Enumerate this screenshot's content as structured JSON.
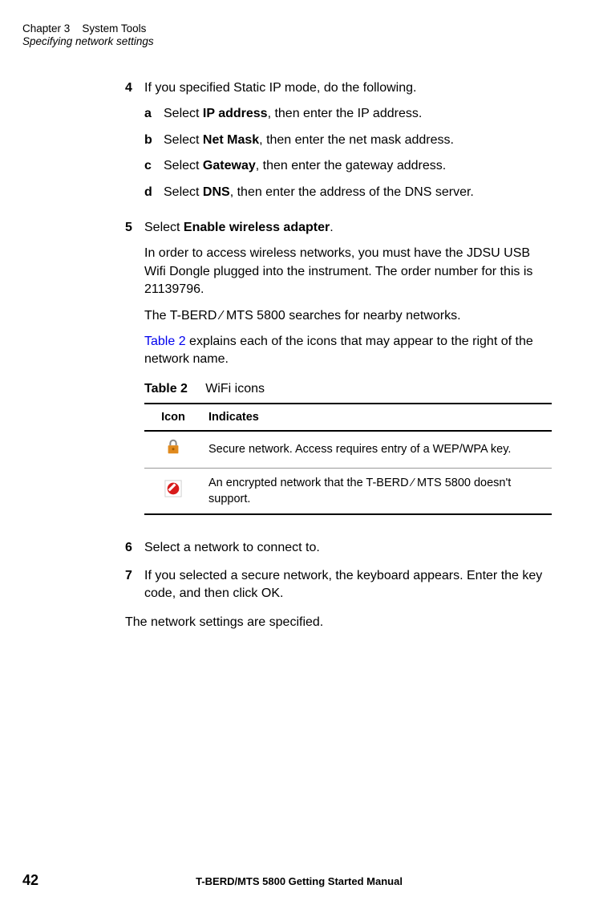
{
  "header": {
    "chapter_prefix": "Chapter 3",
    "chapter_title": "System Tools",
    "section": "Specifying network settings"
  },
  "steps": {
    "s4": {
      "num": "4",
      "intro": "If you specified Static IP mode, do the following.",
      "a": {
        "label": "a",
        "pre": "Select ",
        "bold": "IP address",
        "post": ", then enter the IP address."
      },
      "b": {
        "label": "b",
        "pre": "Select ",
        "bold": "Net Mask",
        "post": ", then enter the net mask address."
      },
      "c": {
        "label": "c",
        "pre": "Select ",
        "bold": "Gateway",
        "post": ", then enter the gateway address."
      },
      "d": {
        "label": "d",
        "pre": "Select ",
        "bold": "DNS",
        "post": ", then enter the address of the DNS server."
      }
    },
    "s5": {
      "num": "5",
      "pre": "Select ",
      "bold": "Enable wireless adapter",
      "post": ".",
      "para1": "In order to access wireless networks, you must have the JDSU USB Wifi Dongle plugged into the instrument. The order number for this is 21139796.",
      "para2": "The T-BERD ⁄ MTS 5800 searches for nearby networks.",
      "para3_link": "Table 2",
      "para3_rest": " explains each of the icons that may appear to the right of the network name."
    },
    "s6": {
      "num": "6",
      "text": "Select a network to connect to."
    },
    "s7": {
      "num": "7",
      "text": "If you selected a secure network, the keyboard appears. Enter the key code, and then click OK."
    }
  },
  "table": {
    "label": "Table 2",
    "caption": "WiFi icons",
    "head_icon": "Icon",
    "head_ind": "Indicates",
    "row1": "Secure network. Access requires entry of a WEP/WPA key.",
    "row2": "An encrypted network that the T-BERD ⁄ MTS 5800 doesn't support."
  },
  "closing": "The network settings are specified.",
  "footer": {
    "page_num": "42",
    "title": "T-BERD/MTS 5800 Getting Started Manual"
  }
}
